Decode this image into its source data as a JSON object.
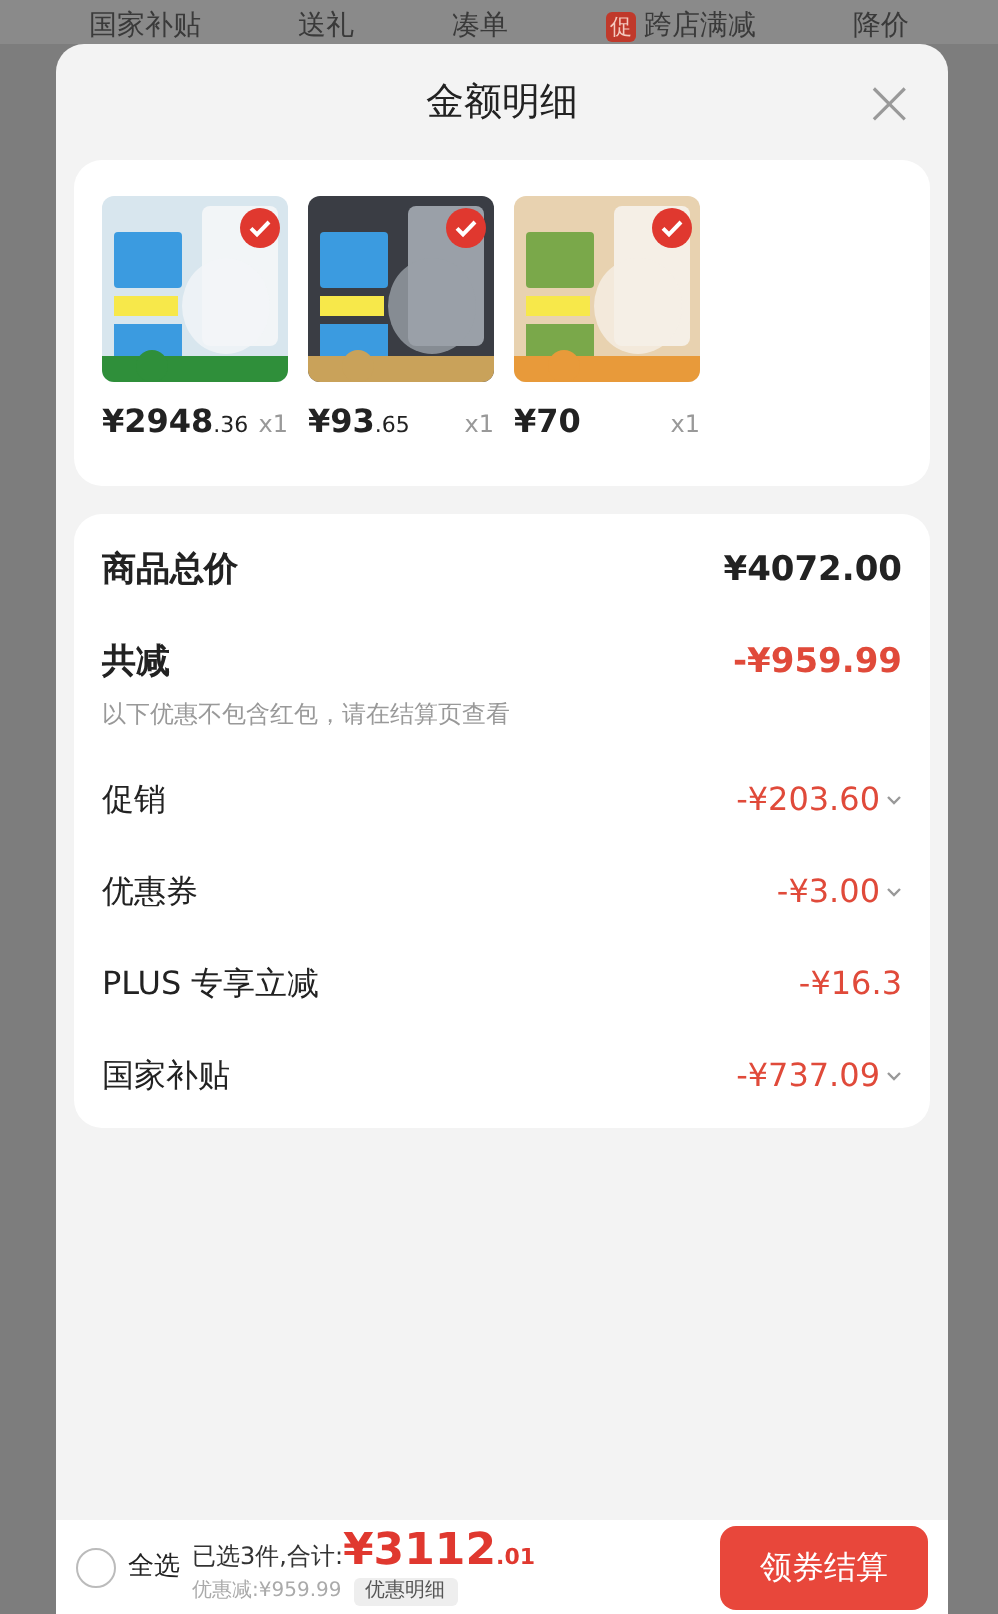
{
  "background_tabs": [
    {
      "label": "国家补贴"
    },
    {
      "label": "送礼"
    },
    {
      "label": "凑单"
    },
    {
      "label": "跨店满减",
      "badge": "促"
    },
    {
      "label": "降价"
    }
  ],
  "sheet": {
    "title": "金额明细",
    "close": "×"
  },
  "products": [
    {
      "kind": "picture",
      "selected": true,
      "price": "¥2948.36",
      "quantity": "x1"
    },
    {
      "kind": "picture",
      "selected": true,
      "price": "¥93.65",
      "quantity": "x1"
    },
    {
      "kind": "picture",
      "selected": true,
      "price": "¥70",
      "quantity": "x1"
    }
  ],
  "summary": {
    "rows": [
      {
        "kind": "total",
        "label": "商品总价",
        "value": "¥4072.00"
      },
      {
        "kind": "discount_total",
        "label": "共减",
        "value": "-¥959.99",
        "note": "以下优惠不包含红包，请在结算页查看"
      },
      {
        "kind": "discount",
        "label": "促销",
        "value": "-¥203.60",
        "expandable": true
      },
      {
        "kind": "discount",
        "label": "优惠券",
        "value": "-¥3.00",
        "expandable": true
      },
      {
        "kind": "discount",
        "label": "PLUS 专享立减",
        "value": "-¥16.3",
        "expandable": false
      },
      {
        "kind": "discount",
        "label": "国家补贴",
        "value": "-¥737.09",
        "expandable": true
      }
    ]
  },
  "bottom_bar": {
    "select_all": {
      "label": "全选",
      "checked": false
    },
    "summary": "已选3件,合计:",
    "total": "¥3112.01",
    "discount": "优惠减:¥959.99",
    "detail_button": "优惠明细",
    "checkout_button": "领券结算"
  }
}
